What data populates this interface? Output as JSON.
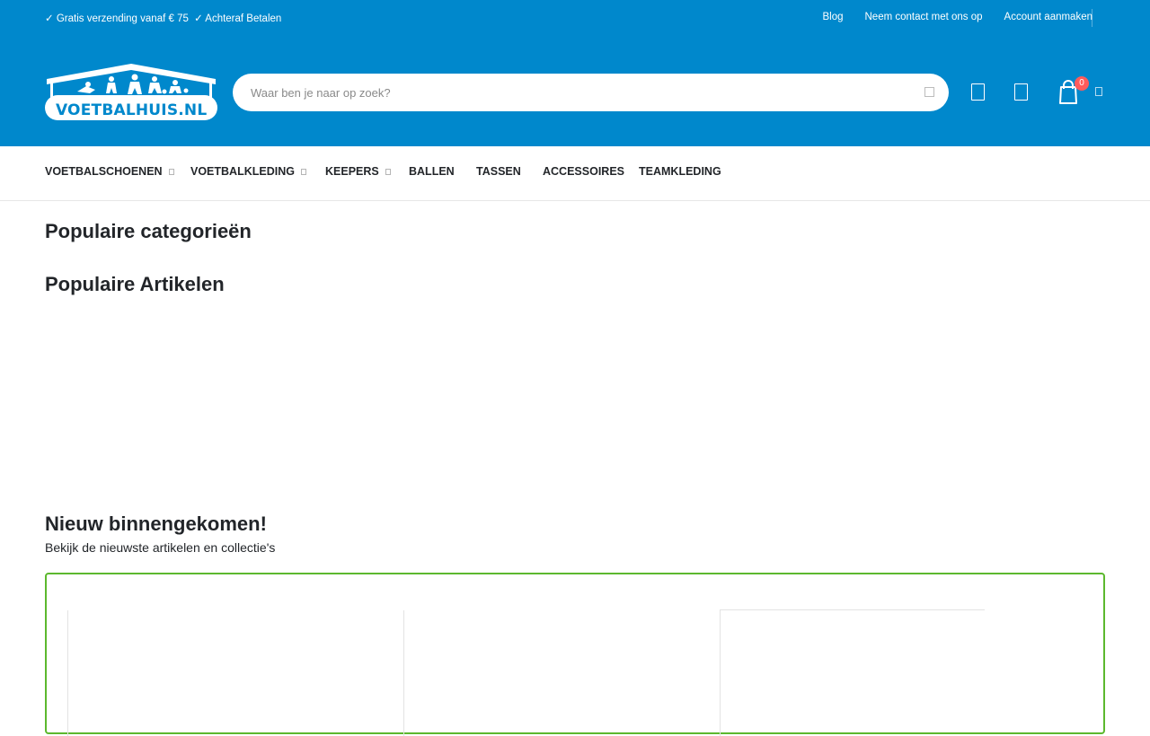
{
  "topbar": {
    "usps": [
      "✓ Gratis verzending vanaf € 75",
      "✓ Achteraf Betalen"
    ],
    "links": [
      "Blog",
      "Neem contact met ons op",
      "Account aanmaken"
    ]
  },
  "logo": {
    "text": "VOETBALHUIS.NL"
  },
  "search": {
    "placeholder": "Waar ben je naar op zoek?"
  },
  "cart": {
    "count": "0"
  },
  "nav": {
    "items": [
      {
        "label": "VOETBALSCHOENEN",
        "has_dropdown": true
      },
      {
        "label": "VOETBALKLEDING",
        "has_dropdown": true
      },
      {
        "label": "KEEPERS",
        "has_dropdown": true
      },
      {
        "label": "BALLEN",
        "has_dropdown": false
      },
      {
        "label": "TASSEN",
        "has_dropdown": false
      },
      {
        "label": "ACCESSOIRES",
        "has_dropdown": false
      },
      {
        "label": "TEAMKLEDING",
        "has_dropdown": false
      }
    ]
  },
  "sections": {
    "categories_title": "Populaire categorieën",
    "articles_title": "Populaire Artikelen",
    "new_title": "Nieuw binnengekomen!",
    "new_subtitle": "Bekijk de nieuwste artikelen en collectie's"
  },
  "colors": {
    "brand": "#0088cc",
    "accent_border": "#5cb82e",
    "badge": "#ff5b5b"
  }
}
